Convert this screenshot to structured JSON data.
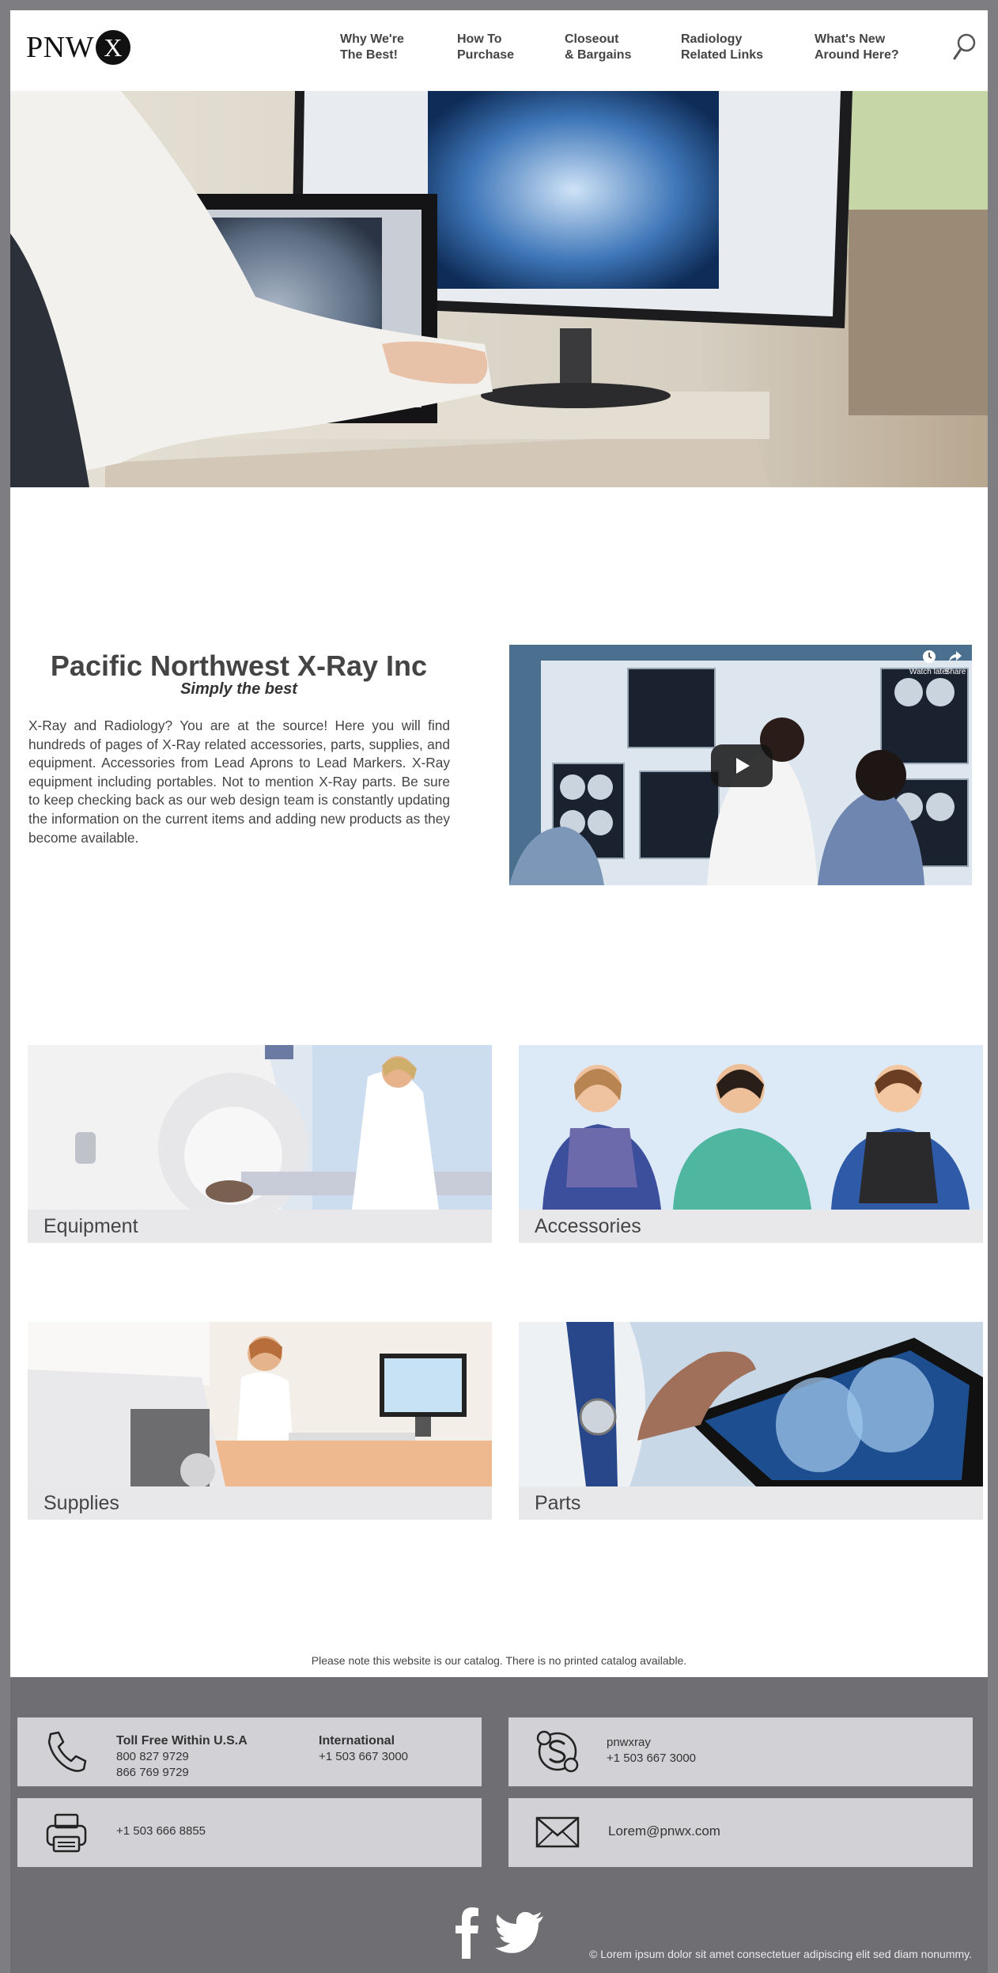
{
  "logo": {
    "text": "PNW",
    "badge": "X"
  },
  "nav": [
    {
      "line1": "Why We're",
      "line2": "The Best!"
    },
    {
      "line1": "How To",
      "line2": "Purchase"
    },
    {
      "line1": "Closeout",
      "line2": "& Bargains"
    },
    {
      "line1": "Radiology",
      "line2": "Related Links"
    },
    {
      "line1": "What's New",
      "line2": "Around Here?"
    }
  ],
  "intro": {
    "title": "Pacific Northwest X-Ray Inc",
    "subtitle": "Simply the best",
    "body": "X-Ray and Radiology? You are at the source! Here you will find hundreds of pages of X-Ray related accessories, parts, supplies, and equipment. Accessories from Lead Aprons to Lead Markers. X-Ray equipment including portables. Not to mention X-Ray parts. Be sure to keep checking back as our web design team is constantly updating the information on the current items and adding new products as they become available."
  },
  "video": {
    "watch_later": "Watch later",
    "share": "Share"
  },
  "categories": [
    {
      "label": "Equipment"
    },
    {
      "label": "Accessories"
    },
    {
      "label": "Supplies"
    },
    {
      "label": "Parts"
    }
  ],
  "catalog_note": "Please note this website is our catalog. There is no printed catalog available.",
  "contact": {
    "toll_free_heading": "Toll Free Within U.S.A",
    "toll_free_1": "800 827 9729",
    "toll_free_2": "866 769 9729",
    "intl_heading": "International",
    "intl_phone": "+1 503 667 3000",
    "skype_user": "pnwxray",
    "skype_phone": "+1 503 667 3000",
    "fax": "+1 503 666 8855",
    "email": "Lorem@pnwx.com"
  },
  "copyright": "© Lorem ipsum dolor sit amet consectetuer adipiscing elit sed diam nonummy."
}
